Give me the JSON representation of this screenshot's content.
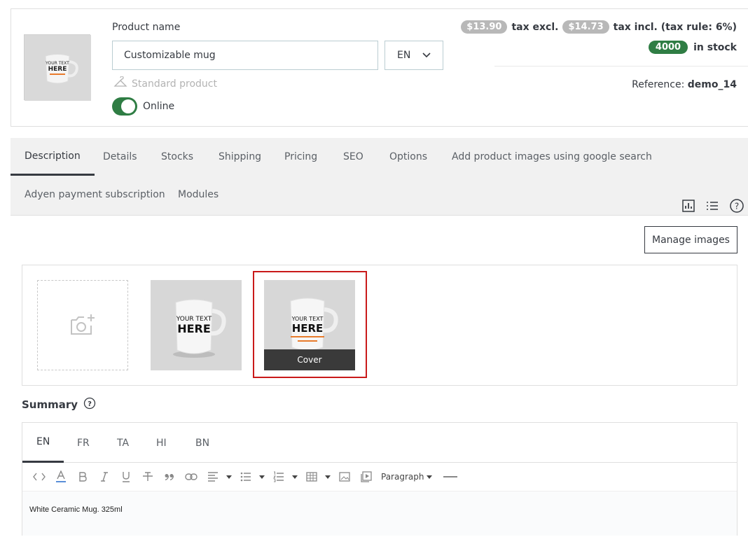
{
  "product": {
    "name_label": "Product name",
    "name_value": "Customizable mug",
    "language": "EN",
    "product_type": "Standard product",
    "status_label": "Online"
  },
  "pricing": {
    "price_excl": "$13.90",
    "tax_excl_label": "tax excl.",
    "price_incl": "$14.73",
    "tax_incl_label": "tax incl. (tax rule: 6%)",
    "stock_qty": "4000",
    "stock_label": "in stock",
    "reference_label": "Reference:",
    "reference_value": "demo_14"
  },
  "tabs": [
    {
      "label": "Description"
    },
    {
      "label": "Details"
    },
    {
      "label": "Stocks"
    },
    {
      "label": "Shipping"
    },
    {
      "label": "Pricing"
    },
    {
      "label": "SEO"
    },
    {
      "label": "Options"
    },
    {
      "label": "Add product images using google search"
    },
    {
      "label": "Adyen payment subscription"
    },
    {
      "label": "Modules"
    }
  ],
  "images": {
    "manage_label": "Manage images",
    "cover_label": "Cover",
    "mug_text_line1": "YOUR TEXT",
    "mug_text_line2": "HERE"
  },
  "summary": {
    "title": "Summary",
    "languages": [
      "EN",
      "FR",
      "TA",
      "HI",
      "BN"
    ],
    "paragraph_label": "Paragraph",
    "content": "White Ceramic Mug. 325ml"
  },
  "colors": {
    "accent_green": "#2f7d44",
    "cover_border": "#c91a1a",
    "price_pill": "#b8b8b8"
  }
}
